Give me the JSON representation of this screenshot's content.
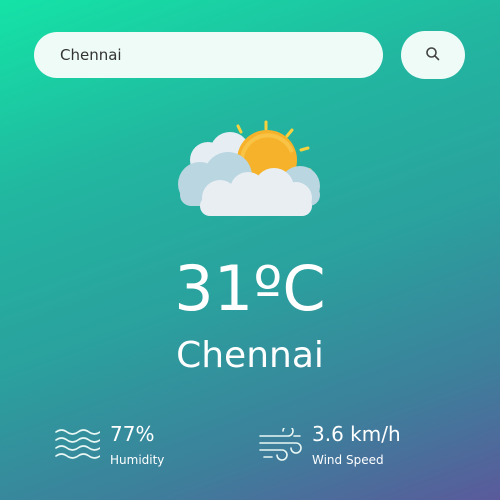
{
  "search": {
    "value": "Chennai",
    "button_icon": "search-icon"
  },
  "weather": {
    "icon": "partly-cloudy-icon",
    "temperature": "31ºC",
    "city": "Chennai"
  },
  "humidity": {
    "icon": "humidity-waves-icon",
    "value": "77%",
    "label": "Humidity"
  },
  "wind": {
    "icon": "wind-icon",
    "value": "3.6 km/h",
    "label": "Wind Speed"
  },
  "colors": {
    "gradient_top": "#14e3a6",
    "gradient_bottom": "#5a5a9b",
    "search_bg": "#eefbf7",
    "sun": "#f9b62b",
    "cloud": "#dce9f0"
  }
}
